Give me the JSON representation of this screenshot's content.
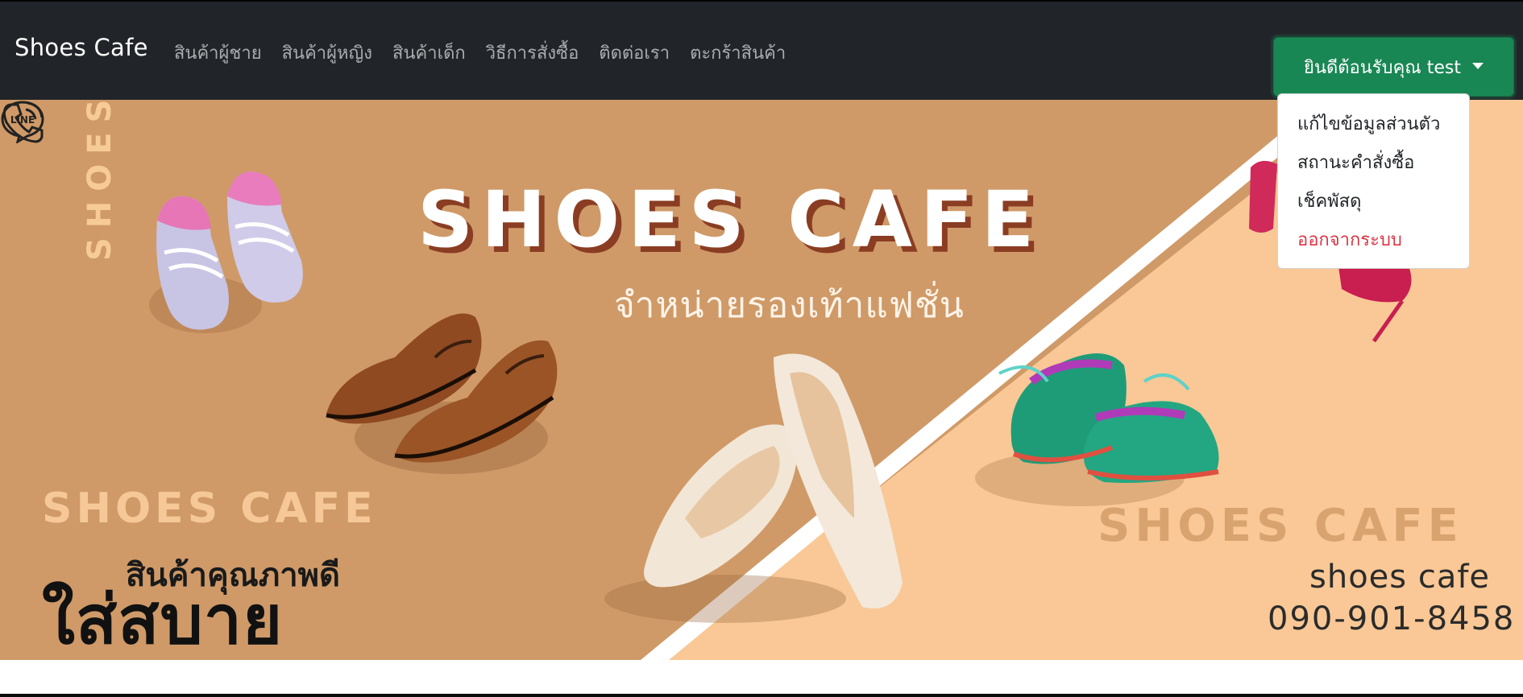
{
  "navbar": {
    "brand": "Shoes Cafe",
    "links": [
      {
        "label": "สินค้าผู้ชาย"
      },
      {
        "label": "สินค้าผู้หญิง"
      },
      {
        "label": "สินค้าเด็ก"
      },
      {
        "label": "วิธีการสั่งซื้อ"
      },
      {
        "label": "ติดต่อเรา"
      },
      {
        "label": "ตะกร้าสินค้า"
      }
    ],
    "user_menu": {
      "label": "ยินดีต้อนรับคุณ test",
      "icon": "caret-down-icon",
      "items": [
        {
          "label": "แก้ไขข้อมูลส่วนตัว"
        },
        {
          "label": "สถานะคำสั่งซื้อ"
        },
        {
          "label": "เช็คพัสดุ"
        },
        {
          "label": "ออกจากระบบ"
        }
      ]
    }
  },
  "banner": {
    "title": "SHOES CAFE",
    "subtitle": "จำหน่ายรองเท้าแฟชั่น",
    "side_text": "SHOES CAFE",
    "left_brand": "SHOES CAFE",
    "right_brand": "SHOES CAFE",
    "promo_line1": "สินค้าคุณภาพดี",
    "promo_line2": "ใส่สบาย",
    "line_icon_text": "LINE",
    "line_name": "shoes cafe",
    "phone": "090-901-8458"
  },
  "colors": {
    "navbar_bg": "#212529",
    "nav_link": "#a9acae",
    "user_button": "#198754",
    "logout": "#dc3545",
    "banner_left": "#cf9a68",
    "banner_right": "#f9c896"
  }
}
